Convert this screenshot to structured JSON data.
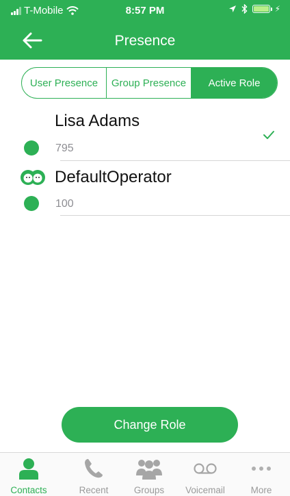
{
  "status_bar": {
    "carrier": "T-Mobile",
    "time": "8:57 PM"
  },
  "header": {
    "title": "Presence"
  },
  "segments": {
    "items": [
      "User Presence",
      "Group Presence",
      "Active Role"
    ],
    "selected": "Active Role"
  },
  "contacts": [
    {
      "name": "Lisa Adams",
      "number": "795",
      "selected": true
    },
    {
      "name": "DefaultOperator",
      "number": "100",
      "selected": false
    }
  ],
  "actions": {
    "change_role": "Change Role"
  },
  "tabs": {
    "items": [
      "Contacts",
      "Recent",
      "Groups",
      "Voicemail",
      "More"
    ],
    "selected": "Contacts"
  },
  "colors": {
    "accent": "#2db055",
    "presence_available": "#2db055",
    "battery_fill": "#b8ef8a"
  }
}
